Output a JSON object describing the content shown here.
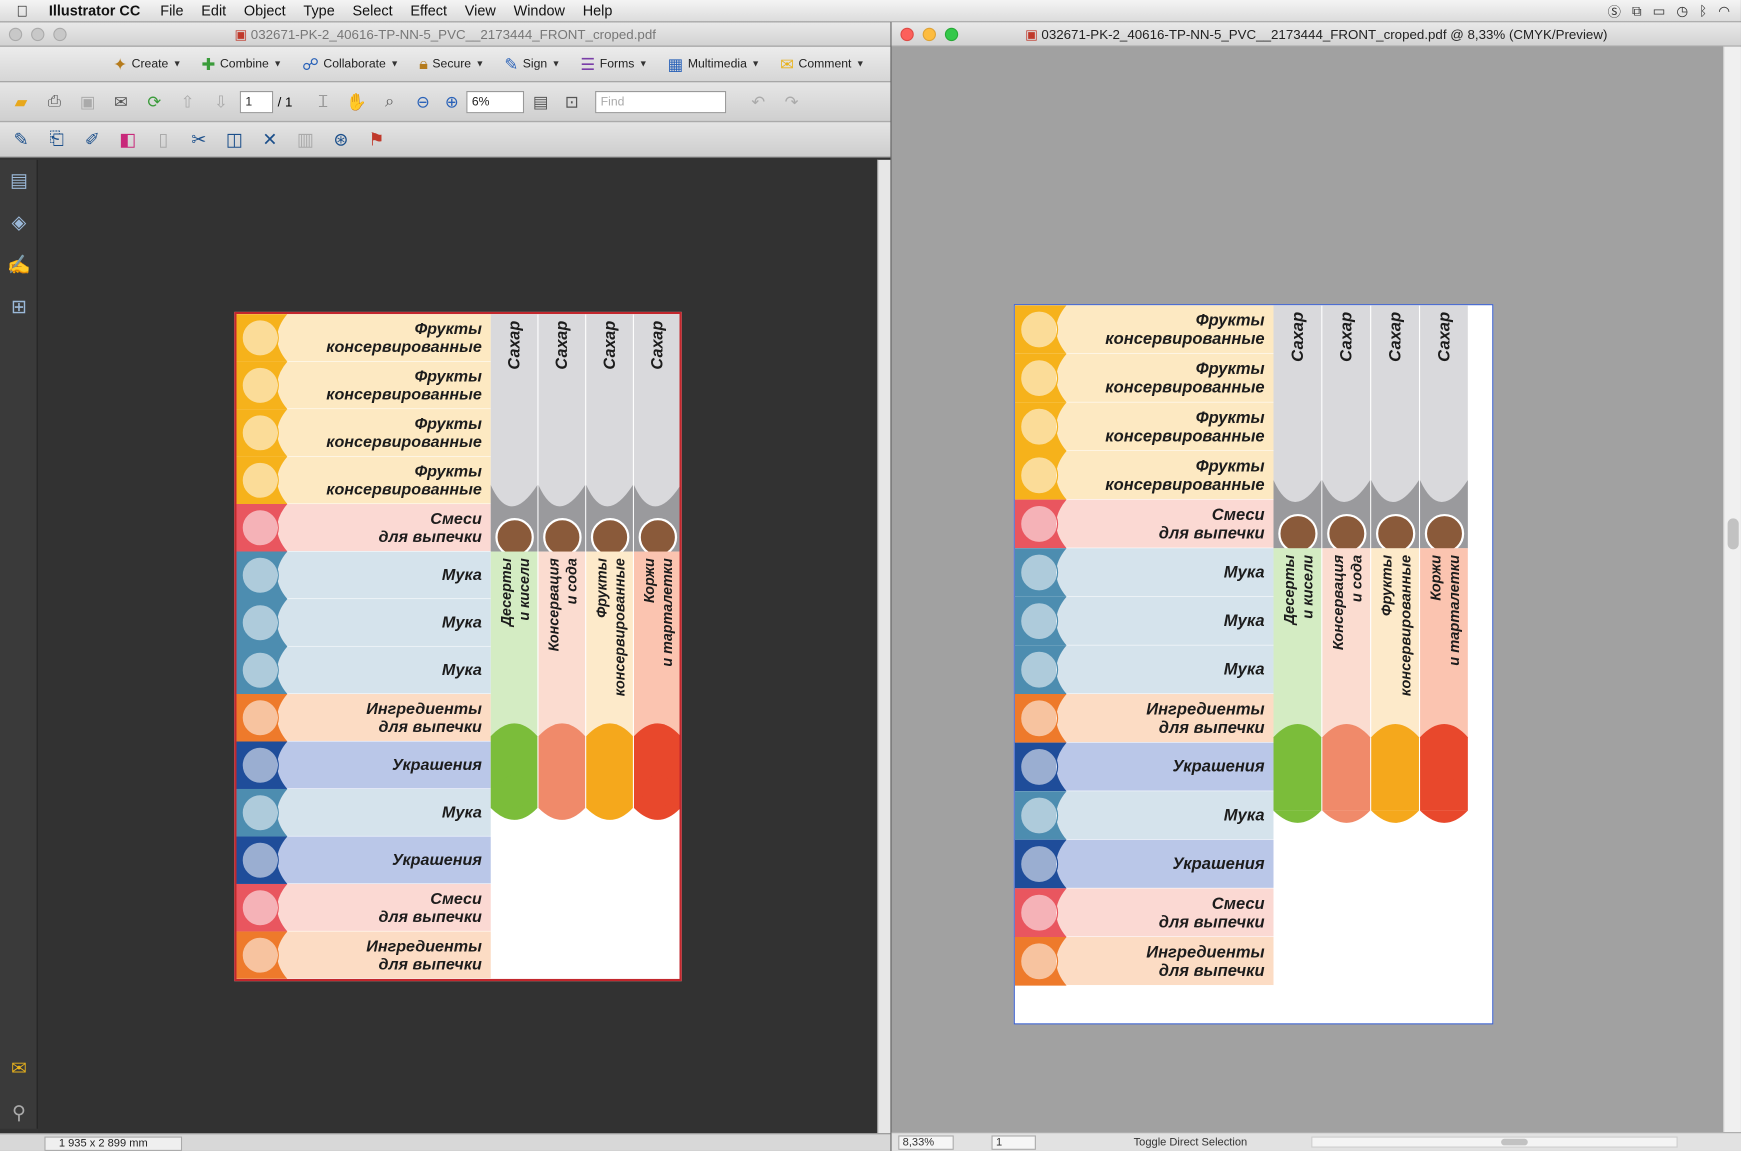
{
  "menubar": {
    "app_name": "Illustrator CC",
    "items": [
      "File",
      "Edit",
      "Object",
      "Type",
      "Select",
      "Effect",
      "View",
      "Window",
      "Help"
    ]
  },
  "left_window": {
    "title": "032671-PK-2_40616-TP-NN-5_PVC__2173444_FRONT_croped.pdf",
    "toolbar1": [
      "Create",
      "Combine",
      "Collaborate",
      "Secure",
      "Sign",
      "Forms",
      "Multimedia",
      "Comment"
    ],
    "page_current": "1",
    "page_total": "/ 1",
    "zoom": "6%",
    "find_placeholder": "Find",
    "status_dims": "1 935 x 2 899 mm"
  },
  "right_window": {
    "title": "032671-PK-2_40616-TP-NN-5_PVC__2173444_FRONT_croped.pdf @ 8,33% (CMYK/Preview)",
    "zoom": "8,33%",
    "page": "1",
    "status_tool": "Toggle Direct Selection"
  },
  "labels": {
    "rows": [
      {
        "l1": "Фрукты",
        "l2": "консервированные",
        "color": "#f6b21b",
        "bg": "#fde9c2",
        "icon": "peach-icon"
      },
      {
        "l1": "Фрукты",
        "l2": "консервированные",
        "color": "#f6b21b",
        "bg": "#fde9c2",
        "icon": "peach-icon"
      },
      {
        "l1": "Фрукты",
        "l2": "консервированные",
        "color": "#f6b21b",
        "bg": "#fde9c2",
        "icon": "peach-icon"
      },
      {
        "l1": "Фрукты",
        "l2": "консервированные",
        "color": "#f6b21b",
        "bg": "#fde9c2",
        "icon": "peach-icon"
      },
      {
        "l1": "Смеси",
        "l2": "для выпечки",
        "color": "#e9565f",
        "bg": "#fbd9d3",
        "icon": "biscuit-icon"
      },
      {
        "l1": "Мука",
        "l2": "",
        "color": "#4d8db0",
        "bg": "#d5e3ec",
        "icon": "flour-icon"
      },
      {
        "l1": "Мука",
        "l2": "",
        "color": "#4d8db0",
        "bg": "#d5e3ec",
        "icon": "flour-icon"
      },
      {
        "l1": "Мука",
        "l2": "",
        "color": "#4d8db0",
        "bg": "#d5e3ec",
        "icon": "flour-icon"
      },
      {
        "l1": "Ингредиенты",
        "l2": "для выпечки",
        "color": "#ee7a2b",
        "bg": "#fcdcc4",
        "icon": "bread-icon"
      },
      {
        "l1": "Украшения",
        "l2": "",
        "color": "#1f4d9a",
        "bg": "#bac7e8",
        "icon": "decoration-icon"
      },
      {
        "l1": "Мука",
        "l2": "",
        "color": "#4d8db0",
        "bg": "#d5e3ec",
        "icon": "flour-icon"
      },
      {
        "l1": "Украшения",
        "l2": "",
        "color": "#1f4d9a",
        "bg": "#bac7e8",
        "icon": "decoration-icon"
      },
      {
        "l1": "Смеси",
        "l2": "для выпечки",
        "color": "#e9565f",
        "bg": "#fbd9d3",
        "icon": "biscuit-icon"
      },
      {
        "l1": "Ингредиенты",
        "l2": "для выпечки",
        "color": "#ee7a2b",
        "bg": "#fcdcc4",
        "icon": "bread-icon"
      }
    ],
    "sugar": [
      "Сахар",
      "Сахар",
      "Сахар",
      "Сахар"
    ],
    "strips": [
      {
        "l1": "Десерты",
        "l2": "и кисели",
        "bg": "#d4ecc3",
        "accent": "#7bbd3a"
      },
      {
        "l1": "Консервация",
        "l2": "и сода",
        "bg": "#fbdcd0",
        "accent": "#f08a6a"
      },
      {
        "l1": "Фрукты",
        "l2": "консервированные",
        "bg": "#fdeaca",
        "accent": "#f5a81c"
      },
      {
        "l1": "Коржи",
        "l2": "и тарталетки",
        "bg": "#fbc4b0",
        "accent": "#e8482c"
      }
    ]
  }
}
